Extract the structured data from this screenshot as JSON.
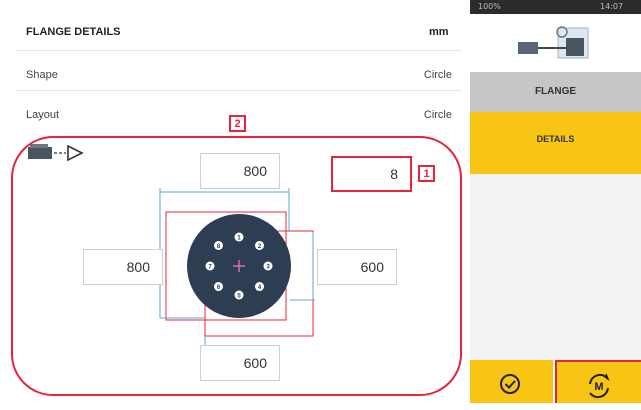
{
  "header": {
    "title": "FLANGE DETAILS",
    "unit": "mm"
  },
  "rows": [
    {
      "label": "Shape",
      "value": "Circle"
    },
    {
      "label": "Layout",
      "value": "Circle"
    }
  ],
  "callouts": {
    "bolts": "1",
    "diagram": "2"
  },
  "fields": {
    "bolt_count": "8",
    "top": "800",
    "left": "800",
    "right": "600",
    "bottom": "600"
  },
  "bolt_labels": [
    "1",
    "2",
    "3",
    "4",
    "5",
    "6",
    "7",
    "8"
  ],
  "sidebar": {
    "status_left": "100%",
    "status_right": "14:07",
    "nav_flange": "FLANGE",
    "nav_details": "DETAILS",
    "buttons": [
      {
        "icon": "check-circle-icon"
      },
      {
        "icon": "measure-mode-icon"
      }
    ]
  },
  "colors": {
    "accent": "#f8c515",
    "highlight": "#e8243c",
    "flange": "#2e3e52",
    "dim_line": "#5aa8d6"
  }
}
